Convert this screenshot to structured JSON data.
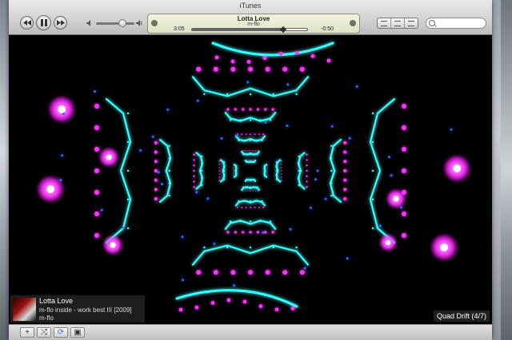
{
  "window": {
    "title": "iTunes"
  },
  "transport": {
    "prev": "previous-track",
    "play_pause": "pause",
    "next": "next-track"
  },
  "now_playing_display": {
    "song": "Lotta Love",
    "artist": "m-flo",
    "elapsed": "3:05",
    "remaining": "-0:50",
    "progress": 0.79
  },
  "volume": {
    "level": 0.6
  },
  "search": {
    "placeholder": ""
  },
  "overlay": {
    "song": "Lotta Love",
    "album": "m-flo inside - work best III [2009]",
    "artist": "m-flo",
    "visualizer": "Quad Drift (4/7)"
  },
  "bottom_buttons": [
    "+",
    "⤮",
    "⟳",
    "▣"
  ],
  "colors": {
    "viz_magenta": "#ff33ff",
    "viz_cyan": "#33ffff",
    "viz_blue": "#3366ff"
  }
}
